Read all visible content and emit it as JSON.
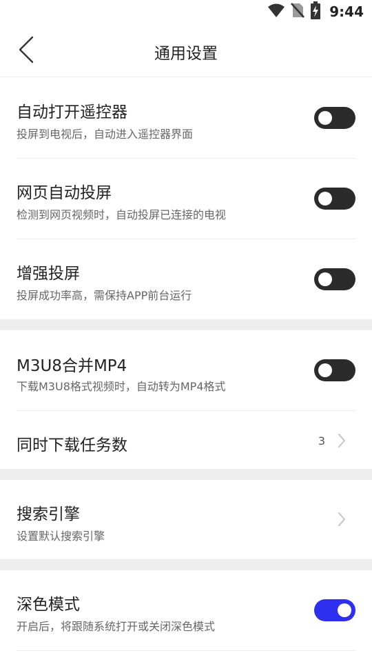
{
  "status_bar": {
    "time": "9:44",
    "icons": [
      "wifi-icon",
      "no-sim-icon",
      "battery-charging-icon"
    ]
  },
  "header": {
    "title": "通用设置",
    "back_icon": "back-chevron-icon"
  },
  "settings": {
    "auto_remote": {
      "title": "自动打开遥控器",
      "subtitle": "投屏到电视后，自动进入遥控器界面",
      "enabled": false
    },
    "web_auto_cast": {
      "title": "网页自动投屏",
      "subtitle": "检测到网页视频时，自动投屏已连接的电视",
      "enabled": false
    },
    "enhanced_cast": {
      "title": "增强投屏",
      "subtitle": "投屏成功率高，需保持APP前台运行",
      "enabled": false
    },
    "m3u8_merge": {
      "title": "M3U8合并MP4",
      "subtitle": "下载M3U8格式视频时，自动转为MP4格式",
      "enabled": false
    },
    "concurrent_downloads": {
      "title": "同时下载任务数",
      "value": "3"
    },
    "search_engine": {
      "title": "搜索引擎",
      "subtitle": "设置默认搜索引擎"
    },
    "dark_mode": {
      "title": "深色模式",
      "subtitle": "开启后，将跟随系统打开或关闭深色模式",
      "enabled": true
    }
  },
  "colors": {
    "toggle_on": "#2f2ff0",
    "toggle_off": "#2b2b2b",
    "section_gap": "#eeeeee"
  }
}
